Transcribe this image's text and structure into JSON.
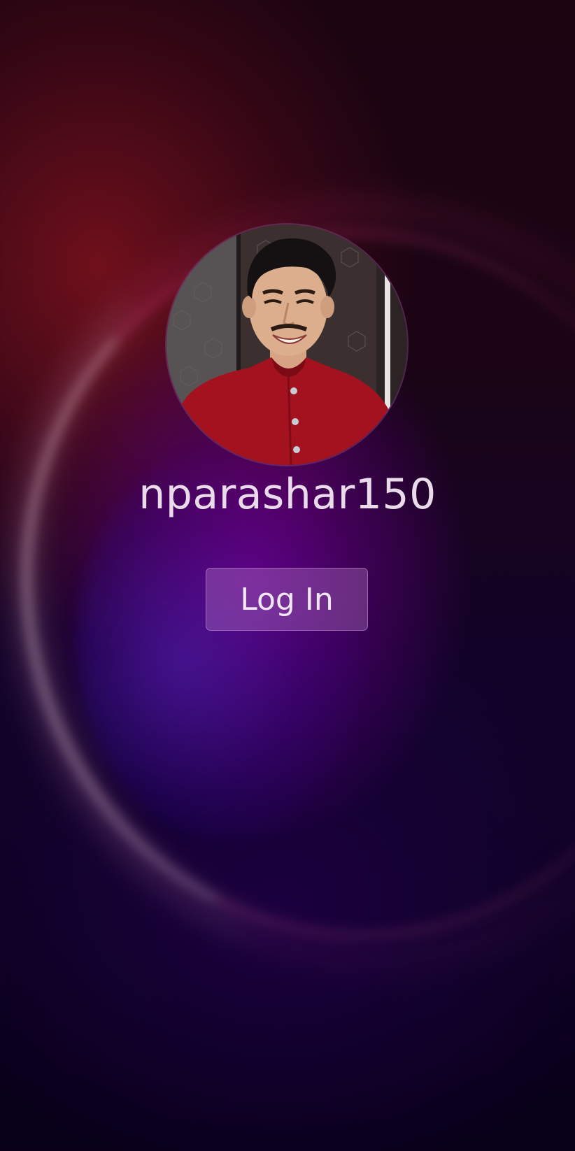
{
  "user": {
    "username": "nparashar150",
    "avatar_alt": "user-avatar-photo"
  },
  "actions": {
    "login_label": "Log In"
  },
  "theme": {
    "text_color": "#eadbea",
    "button_bg": "rgba(200,140,210,0.32)",
    "accent_magenta": "#8a0a8a",
    "accent_crimson": "#8c1428",
    "background_dark": "#080018"
  }
}
